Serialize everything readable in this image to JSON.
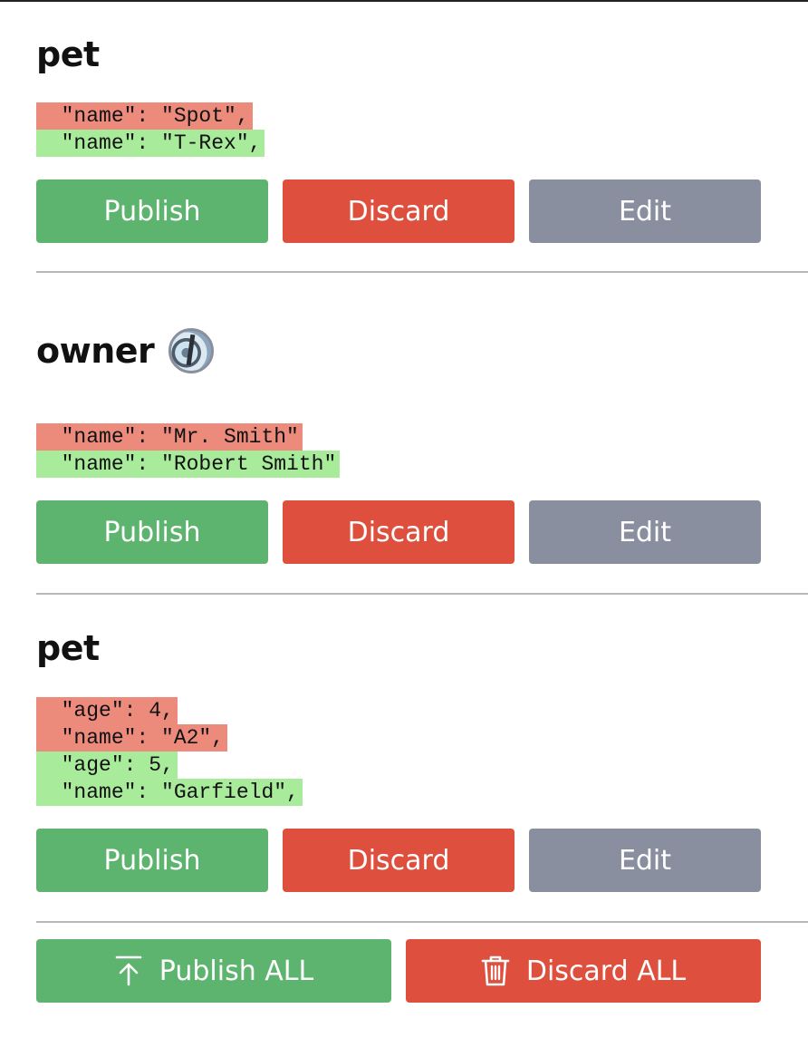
{
  "sections": [
    {
      "title": "pet",
      "removed": [
        "  \"name\": \"Spot\","
      ],
      "added": [
        "  \"name\": \"T-Rex\","
      ],
      "publish_label": "Publish",
      "discard_label": "Discard",
      "edit_label": "Edit"
    },
    {
      "title": "owner",
      "has_avatar": true,
      "removed": [
        "  \"name\": \"Mr. Smith\""
      ],
      "added": [
        "  \"name\": \"Robert Smith\""
      ],
      "publish_label": "Publish",
      "discard_label": "Discard",
      "edit_label": "Edit"
    },
    {
      "title": "pet",
      "removed": [
        "  \"age\": 4,",
        "  \"name\": \"A2\","
      ],
      "added": [
        "  \"age\": 5,",
        "  \"name\": \"Garfield\","
      ],
      "publish_label": "Publish",
      "discard_label": "Discard",
      "edit_label": "Edit"
    }
  ],
  "footer": {
    "publish_all_label": "Publish ALL",
    "discard_all_label": "Discard ALL",
    "publish_all_icon": "upload-arrow-icon",
    "discard_all_icon": "trash-icon"
  },
  "colors": {
    "publish": "#5db46e",
    "discard": "#de4f3d",
    "edit": "#8a8f9f",
    "removed_bg": "#ec8b7c",
    "added_bg": "#a8ec9b"
  }
}
